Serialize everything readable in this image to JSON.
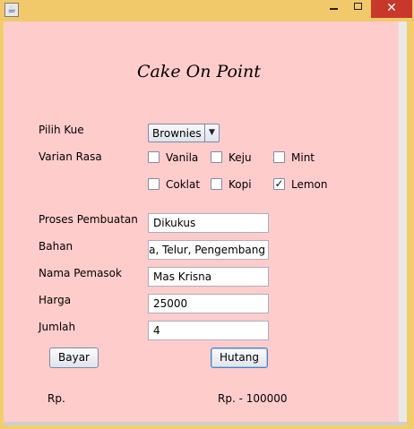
{
  "window": {
    "icon": "java-cup-icon",
    "controls": {
      "minimize": "minimize-icon",
      "maximize": "maximize-icon",
      "close": "✕"
    }
  },
  "header": {
    "title": "Cake On Point"
  },
  "form": {
    "pilih_kue_label": "Pilih Kue",
    "kue_selected": "Brownies",
    "varian_label": "Varian Rasa",
    "varian": [
      {
        "label": "Vanila",
        "checked": false
      },
      {
        "label": "Keju",
        "checked": false
      },
      {
        "label": "Mint",
        "checked": false
      },
      {
        "label": "Coklat",
        "checked": false
      },
      {
        "label": "Kopi",
        "checked": false
      },
      {
        "label": "Lemon",
        "checked": true
      }
    ],
    "proses_label": "Proses Pembuatan",
    "proses_value": "Dikukus",
    "bahan_label": "Bahan",
    "bahan_value": "ga, Telur, Pengembang",
    "pemasok_label": "Nama Pemasok",
    "pemasok_value": "Mas Krisna",
    "harga_label": "Harga",
    "harga_value": "25000",
    "jumlah_label": "Jumlah",
    "jumlah_value": "4"
  },
  "actions": {
    "bayar": "Bayar",
    "hutang": "Hutang"
  },
  "output": {
    "bayar_result": "Rp.",
    "hutang_result": "Rp. - 100000"
  },
  "colors": {
    "background": "#ffcccc",
    "titlebar": "#f2c96a",
    "close": "#c7382b"
  }
}
